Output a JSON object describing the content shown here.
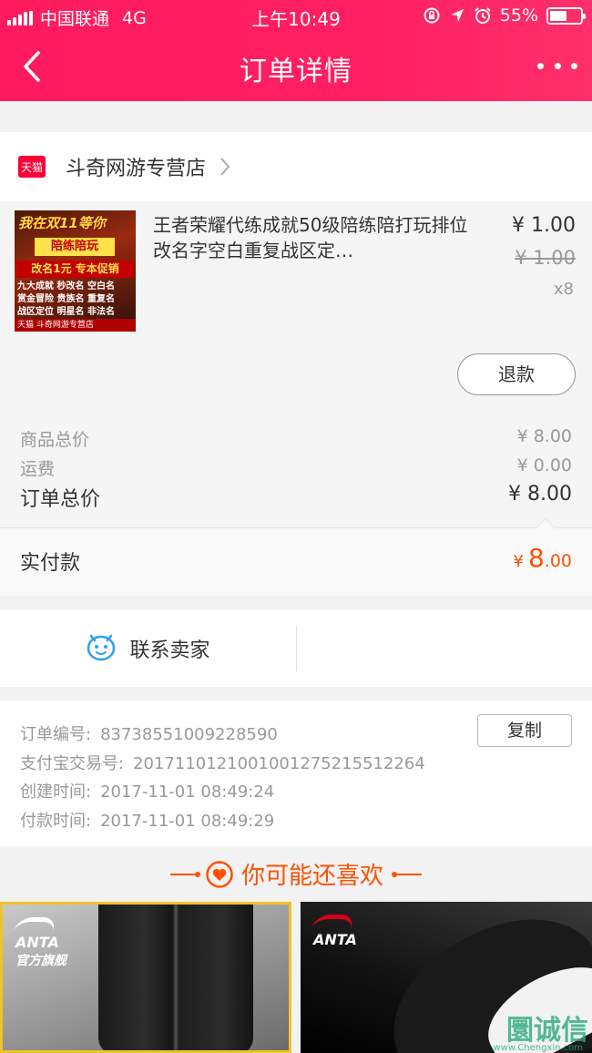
{
  "status_bar": {
    "carrier": "中国联通",
    "network": "4G",
    "time": "上午10:49",
    "battery": "55%"
  },
  "nav": {
    "title": "订单详情",
    "back_icon": "chevron-left-icon",
    "more_icon": "more-dots-icon"
  },
  "shop": {
    "badge": "天猫",
    "name": "斗奇网游专营店"
  },
  "product": {
    "title": "王者荣耀代练成就50级陪练陪打玩排位改名字空白重复战区定…",
    "price": "¥ 1.00",
    "original_price": "¥ 1.00",
    "quantity": "x8",
    "refund_label": "退款",
    "image_text": {
      "headline": "我在双11等你",
      "banner": "陪练陪玩",
      "promo": "改名1元 专本促销",
      "lines": [
        "九大成就 秒改名 空白名",
        "赏金冒险 贵族名 重复名",
        "战区定位 明星名 非法名"
      ],
      "footer": "天猫 斗奇网游专营店"
    }
  },
  "summary": {
    "goods_total_label": "商品总价",
    "goods_total": "¥ 8.00",
    "shipping_label": "运费",
    "shipping": "¥ 0.00",
    "order_total_label": "订单总价",
    "order_total": "¥ 8.00"
  },
  "payment": {
    "label": "实付款",
    "currency": "¥",
    "integer": "8",
    "decimal": ".00",
    "accent_color": "#ff5000"
  },
  "contact": {
    "label": "联系卖家",
    "icon": "chat-bubble-icon"
  },
  "order_info": {
    "order_no_label": "订单编号:",
    "order_no": "83738551009228590",
    "copy_label": "复制",
    "alipay_no_label": "支付宝交易号:",
    "alipay_no": "2017110121001001275215512264",
    "created_label": "创建时间:",
    "created": "2017-11-01 08:49:24",
    "paid_label": "付款时间:",
    "paid": "2017-11-01 08:49:29"
  },
  "recommend": {
    "title": "你可能还喜欢",
    "icon": "heart-icon",
    "items": [
      {
        "brand": "ANTA",
        "sub": "官方旗舰"
      },
      {
        "brand": "ANTA",
        "sub": ""
      }
    ]
  },
  "watermark": {
    "text": "圜诚信",
    "sub": "www.Chengxin.com"
  },
  "colors": {
    "header": "#ff1f61",
    "accent": "#ff5000",
    "tmall": "#ff0036"
  }
}
